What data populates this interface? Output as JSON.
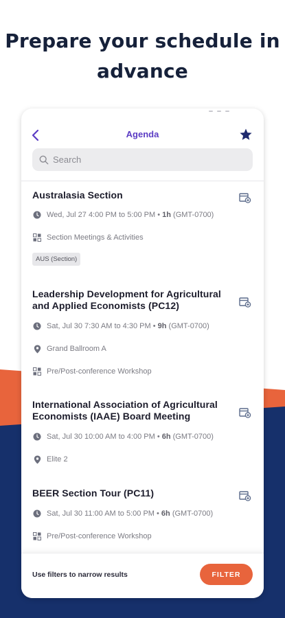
{
  "headline": "Prepare your schedule in advance",
  "colors": {
    "accent_purple": "#5b3cc4",
    "star_navy": "#1f2a6e",
    "orange": "#e8643c",
    "navy": "#16306b"
  },
  "header": {
    "back_icon": "chevron-left-icon",
    "title": "Agenda",
    "favorite_icon": "star-icon"
  },
  "search": {
    "placeholder": "Search",
    "value": ""
  },
  "sessions": [
    {
      "title": "Australasia Section",
      "date": "Wed, Jul 27 4:00 PM to 5:00 PM •",
      "duration": "1h",
      "tz": "(GMT-0700)",
      "location": "",
      "type": "Section Meetings & Activities",
      "tag": "AUS (Section)"
    },
    {
      "title": "Leadership Development for Agricultural and Applied Economists (PC12)",
      "date": "Sat, Jul 30 7:30 AM to 4:30 PM •",
      "duration": "9h",
      "tz": "(GMT-0700)",
      "location": "Grand Ballroom A",
      "type": "Pre/Post-conference Workshop",
      "tag": ""
    },
    {
      "title": "International Association of Agricultural Economists (IAAE) Board Meeting",
      "date": "Sat, Jul 30 10:00 AM to 4:00 PM •",
      "duration": "6h",
      "tz": "(GMT-0700)",
      "location": "Elite 2",
      "type": "",
      "tag": ""
    },
    {
      "title": "BEER Section Tour (PC11)",
      "date": "Sat, Jul 30 11:00 AM to 5:00 PM •",
      "duration": "6h",
      "tz": "(GMT-0700)",
      "location": "",
      "type": "Pre/Post-conference Workshop",
      "tag": ""
    }
  ],
  "footer": {
    "hint": "Use filters to narrow results",
    "filter_label": "FILTER"
  }
}
